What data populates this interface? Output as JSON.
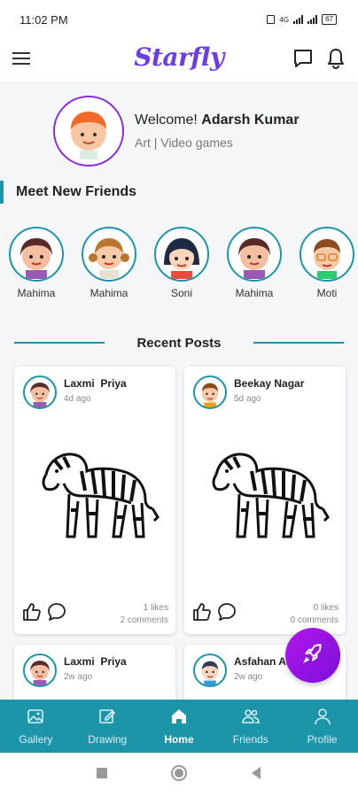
{
  "status_bar": {
    "time": "11:02 PM",
    "network": "4G",
    "battery": "67"
  },
  "header": {
    "logo": "Starfly"
  },
  "welcome": {
    "greeting": "Welcome!",
    "user_name": "Adarsh Kumar",
    "interests": "Art | Video games"
  },
  "friends_section": {
    "title": "Meet New Friends",
    "friends": [
      {
        "name": "Mahima"
      },
      {
        "name": "Mahima"
      },
      {
        "name": "Soni"
      },
      {
        "name": "Mahima"
      },
      {
        "name": "Moti"
      }
    ]
  },
  "recent_posts": {
    "title": "Recent Posts",
    "posts": [
      {
        "author": "Laxmi  Priya",
        "time": "4d ago",
        "likes": "1 likes",
        "comments": "2 comments"
      },
      {
        "author": "Beekay Nagar",
        "time": "5d ago",
        "likes": "0 likes",
        "comments": "0 comments"
      },
      {
        "author": "Laxmi  Priya",
        "time": "2w ago"
      },
      {
        "author": "Asfahan A",
        "time": "2w ago"
      }
    ]
  },
  "bottom_nav": {
    "items": [
      {
        "label": "Gallery",
        "icon": "gallery-icon"
      },
      {
        "label": "Drawing",
        "icon": "drawing-icon"
      },
      {
        "label": "Home",
        "icon": "home-icon",
        "active": true
      },
      {
        "label": "Friends",
        "icon": "friends-icon"
      },
      {
        "label": "Profile",
        "icon": "profile-icon"
      }
    ]
  },
  "colors": {
    "accent": "#1d95a8",
    "brand": "#6b3de8",
    "fab": "#a616e4"
  }
}
